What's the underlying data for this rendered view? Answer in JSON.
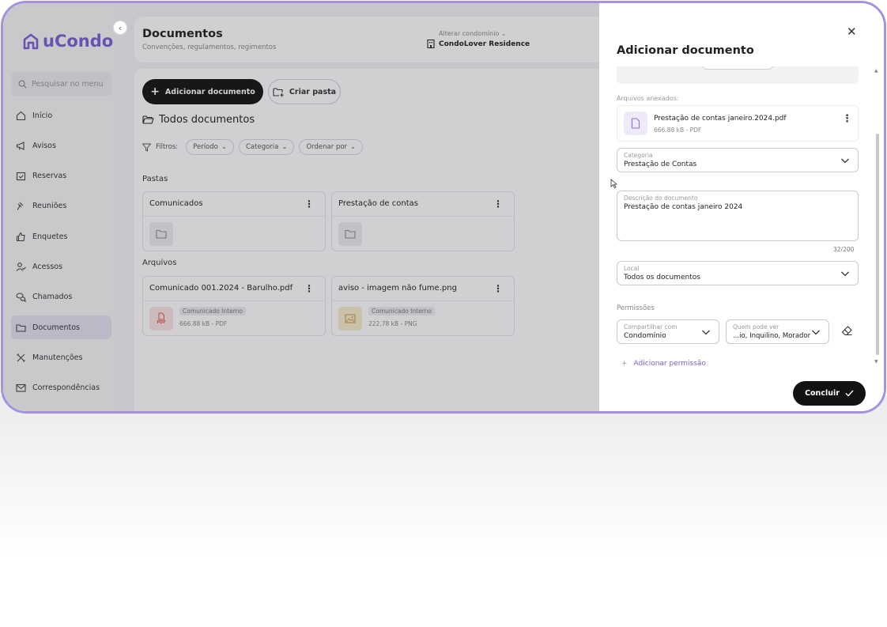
{
  "app": {
    "logo_text": "uCondo"
  },
  "sidebar": {
    "search_placeholder": "Pesquisar no menu",
    "items": [
      {
        "label": "Início",
        "icon": "home-icon"
      },
      {
        "label": "Avisos",
        "icon": "megaphone-icon"
      },
      {
        "label": "Reservas",
        "icon": "calendar-check-icon"
      },
      {
        "label": "Reuniões",
        "icon": "gavel-icon"
      },
      {
        "label": "Enquetes",
        "icon": "thumbs-up-icon"
      },
      {
        "label": "Acessos",
        "icon": "user-check-icon"
      },
      {
        "label": "Chamados",
        "icon": "chat-icon"
      },
      {
        "label": "Documentos",
        "icon": "folder-icon",
        "active": true
      },
      {
        "label": "Manutenções",
        "icon": "tools-icon"
      },
      {
        "label": "Correspondências",
        "icon": "mail-icon"
      }
    ]
  },
  "header": {
    "title": "Documentos",
    "subtitle": "Convenções, regulamentos, regimentos",
    "condo_label": "Alterar condomínio",
    "condo_name": "CondoLover Residence"
  },
  "toolbar": {
    "add_document": "Adicionar documento",
    "create_folder": "Criar pasta"
  },
  "main": {
    "section_title": "Todos documentos",
    "filters_label": "Filtros:",
    "filters": [
      "Período",
      "Categoria",
      "Ordenar por"
    ],
    "folders_label": "Pastas",
    "folders": [
      {
        "name": "Comunicados"
      },
      {
        "name": "Prestação de contas"
      }
    ],
    "files_label": "Arquivos",
    "files": [
      {
        "name": "Comunicado 001.2024 - Barulho.pdf",
        "tag": "Comunicado Interno",
        "meta": "666.88 kB - PDF",
        "type": "PDF",
        "icon": "pdf-icon"
      },
      {
        "name": "aviso - imagem não fume.png",
        "tag": "Comunicado Interno",
        "meta": "222.78 kB - PNG",
        "type": "",
        "icon": "image-icon"
      }
    ]
  },
  "panel": {
    "title": "Adicionar documento",
    "attached_label": "Arquivos anexados:",
    "attached_file": {
      "name": "Prestação de contas janeiro.2024.pdf",
      "meta": "666.88 kB - PDF"
    },
    "category": {
      "label": "Categoria",
      "value": "Prestação de Contas"
    },
    "description": {
      "label": "Descrição do documento",
      "value": "Prestação de contas janeiro 2024",
      "counter": "32/200"
    },
    "location": {
      "label": "Local",
      "value": "Todos os documentos"
    },
    "permissions_label": "Permissões",
    "share_with": {
      "label": "Compartilhar com",
      "value": "Condomínio"
    },
    "who_sees": {
      "label": "Quem pode ver",
      "value": "...io, Inquilino, Morador"
    },
    "add_permission": "Adicionar permissão",
    "conclude": "Concluir"
  },
  "colors": {
    "accent": "#7a5fd6",
    "frame": "#a691e0",
    "primary_button": "#121212"
  }
}
